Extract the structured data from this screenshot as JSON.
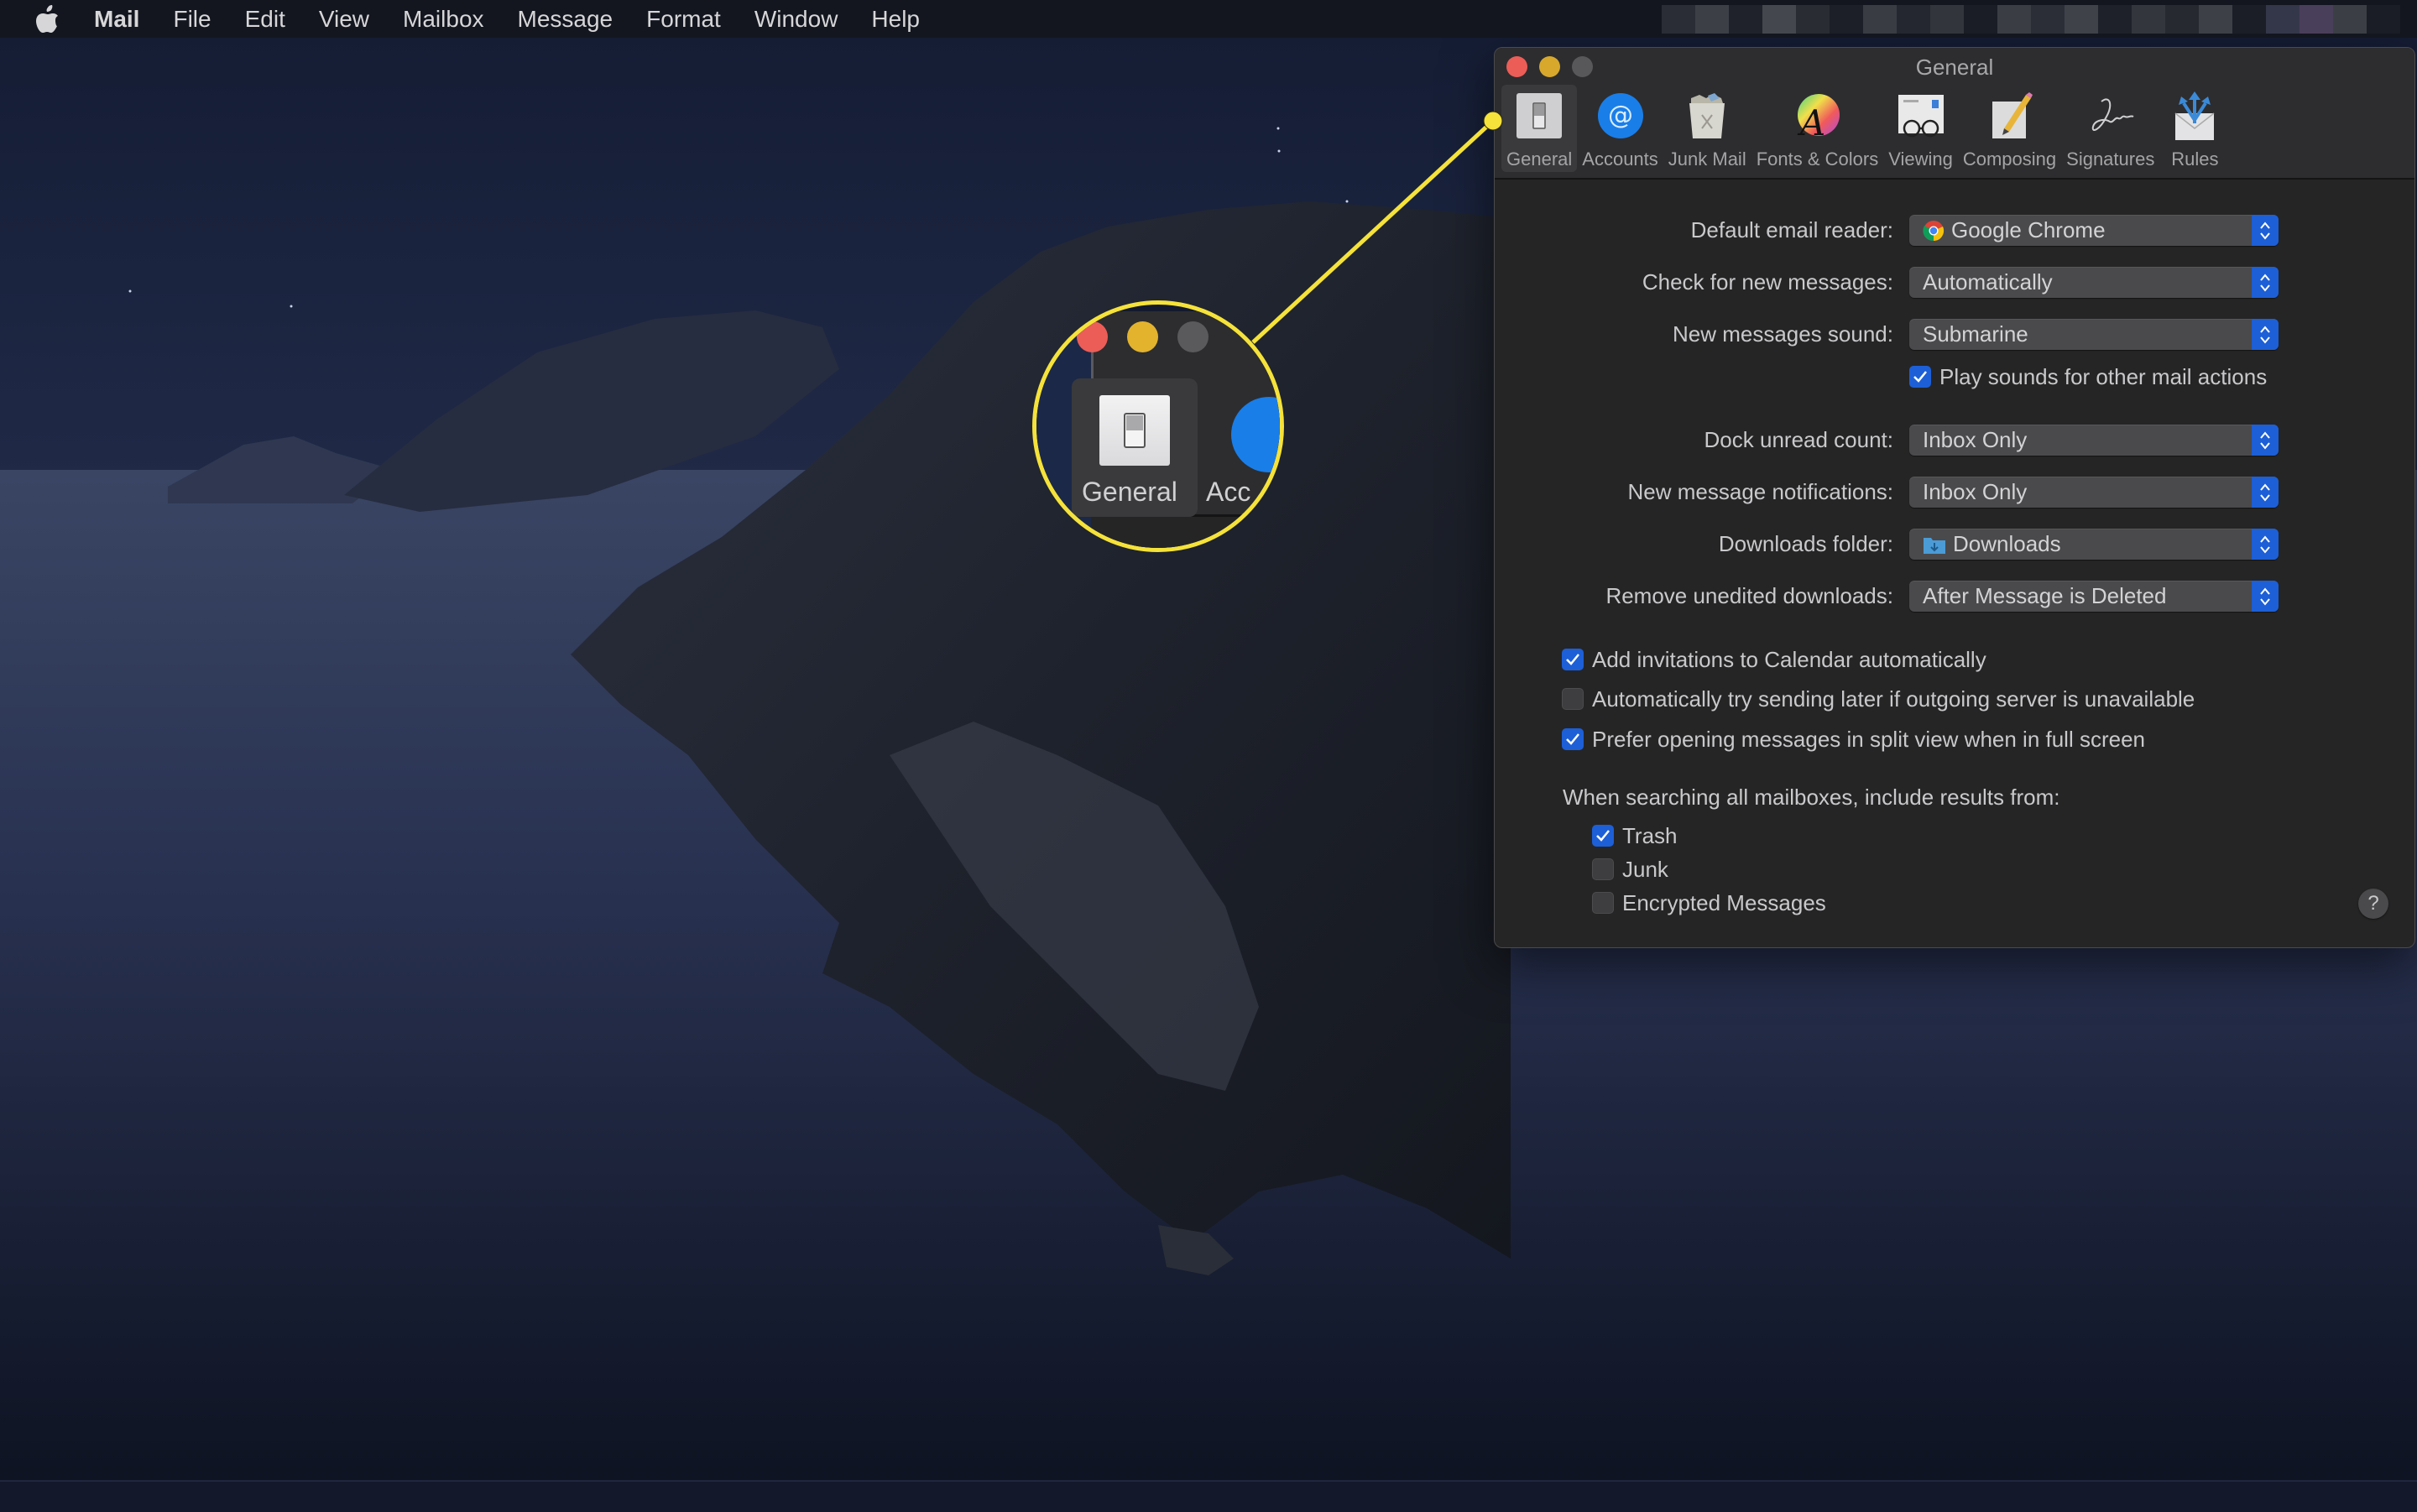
{
  "menubar": {
    "apple_icon": "apple-logo-icon",
    "app_name": "Mail",
    "items": [
      "File",
      "Edit",
      "View",
      "Mailbox",
      "Message",
      "Format",
      "Window",
      "Help"
    ]
  },
  "window": {
    "title": "General",
    "toolbar": [
      {
        "label": "General",
        "icon": "general-switch-icon",
        "selected": true
      },
      {
        "label": "Accounts",
        "icon": "at-sign-icon",
        "selected": false
      },
      {
        "label": "Junk Mail",
        "icon": "trash-bin-icon",
        "selected": false
      },
      {
        "label": "Fonts & Colors",
        "icon": "color-wheel-font-icon",
        "selected": false
      },
      {
        "label": "Viewing",
        "icon": "glasses-document-icon",
        "selected": false
      },
      {
        "label": "Composing",
        "icon": "pencil-paper-icon",
        "selected": false
      },
      {
        "label": "Signatures",
        "icon": "signature-icon",
        "selected": false
      },
      {
        "label": "Rules",
        "icon": "envelope-arrows-icon",
        "selected": false
      }
    ],
    "settings": [
      {
        "label": "Default email reader:",
        "value": "Google Chrome",
        "value_icon": "chrome-icon"
      },
      {
        "label": "Check for new messages:",
        "value": "Automatically"
      },
      {
        "label": "New messages sound:",
        "value": "Submarine"
      },
      {
        "label": "Dock unread count:",
        "value": "Inbox Only"
      },
      {
        "label": "New message notifications:",
        "value": "Inbox Only"
      },
      {
        "label": "Downloads folder:",
        "value": "Downloads",
        "value_icon": "downloads-folder-icon"
      },
      {
        "label": "Remove unedited downloads:",
        "value": "After Message is Deleted"
      }
    ],
    "play_sounds": {
      "label": "Play sounds for other mail actions",
      "checked": true
    },
    "options": [
      {
        "label": "Add invitations to Calendar automatically",
        "checked": true
      },
      {
        "label": "Automatically try sending later if outgoing server is unavailable",
        "checked": false
      },
      {
        "label": "Prefer opening messages in split view when in full screen",
        "checked": true
      }
    ],
    "search_section": {
      "label": "When searching all mailboxes, include results from:",
      "items": [
        {
          "label": "Trash",
          "checked": true
        },
        {
          "label": "Junk",
          "checked": false
        },
        {
          "label": "Encrypted Messages",
          "checked": false
        }
      ]
    },
    "help_label": "?"
  },
  "callout": {
    "magnified_tab_label": "General",
    "magnified_next_label": "Acc",
    "highlight_color": "#f5e23a"
  },
  "colors": {
    "accent": "#1d5fd6",
    "close": "#ec5d57",
    "minimize": "#d7a82c",
    "zoom": "#58585a"
  }
}
